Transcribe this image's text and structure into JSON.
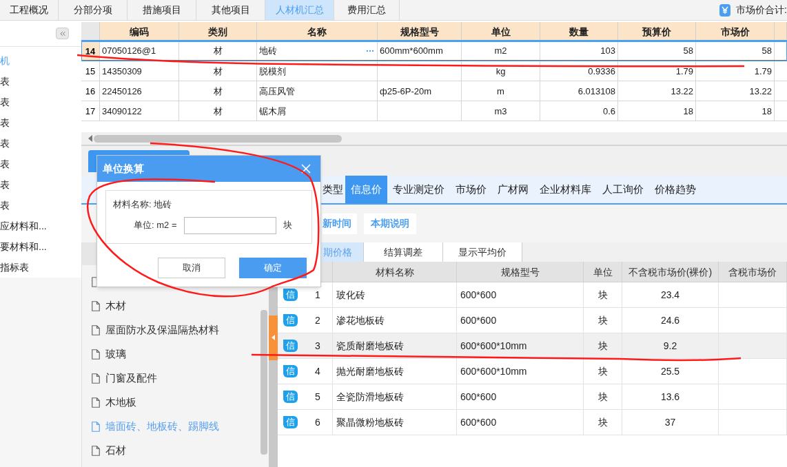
{
  "top_tabs": [
    {
      "label": "工程概况",
      "selected": false
    },
    {
      "label": "分部分项",
      "selected": false
    },
    {
      "label": "措施项目",
      "selected": false
    },
    {
      "label": "其他项目",
      "selected": false
    },
    {
      "label": "人材机汇总",
      "selected": true
    },
    {
      "label": "费用汇总",
      "selected": false
    }
  ],
  "market_total": {
    "label": "市场价合计:"
  },
  "sidebar": {
    "items": [
      {
        "label": "机",
        "selected": true
      },
      {
        "label": "表",
        "selected": false
      },
      {
        "label": "表",
        "selected": false
      },
      {
        "label": "表",
        "selected": false
      },
      {
        "label": "表",
        "selected": false
      },
      {
        "label": "表",
        "selected": false
      },
      {
        "label": "表",
        "selected": false
      },
      {
        "label": "表",
        "selected": false
      },
      {
        "label": "应材料和...",
        "selected": false
      },
      {
        "label": "要材料和...",
        "selected": false
      },
      {
        "label": "指标表",
        "selected": false
      }
    ]
  },
  "material_table": {
    "columns": [
      "编码",
      "类别",
      "名称",
      "规格型号",
      "单位",
      "数量",
      "预算价",
      "市场价"
    ],
    "rows": [
      {
        "number": "14",
        "cells": [
          "07050126@1",
          "材",
          "地砖",
          "600mm*600mm",
          "m2",
          "103",
          "58",
          "58"
        ],
        "selected": true
      },
      {
        "number": "15",
        "cells": [
          "14350309",
          "材",
          "脱模剂",
          "",
          "kg",
          "0.9336",
          "1.79",
          "1.79"
        ],
        "selected": false
      },
      {
        "number": "16",
        "cells": [
          "22450126",
          "材",
          "高压风管",
          "ф25-6P-20m",
          "m",
          "6.013108",
          "13.22",
          "13.22"
        ],
        "selected": false
      },
      {
        "number": "17",
        "cells": [
          "34090122",
          "材",
          "锯木屑",
          "",
          "m3",
          "0.6",
          "18",
          "18"
        ],
        "selected": false
      }
    ]
  },
  "price_tabs": [
    {
      "label": "类型",
      "selected": false
    },
    {
      "label": "信息价",
      "selected": true
    },
    {
      "label": "专业测定价",
      "selected": false
    },
    {
      "label": "市场价",
      "selected": false
    },
    {
      "label": "广材网",
      "selected": false
    },
    {
      "label": "企业材料库",
      "selected": false
    },
    {
      "label": "人工询价",
      "selected": false
    },
    {
      "label": "价格趋势",
      "selected": false
    }
  ],
  "actions": [
    "新时间",
    "本期说明"
  ],
  "sub_tabs": [
    {
      "label": "期价格",
      "selected": true
    },
    {
      "label": "结算调差",
      "selected": false
    },
    {
      "label": "显示平均价",
      "selected": false
    }
  ],
  "category_tree": {
    "items": [
      {
        "selected": false
      },
      {
        "label": "木材",
        "selected": false
      },
      {
        "label": "屋面防水及保温隔热材料",
        "selected": false
      },
      {
        "label": "玻璃",
        "selected": false
      },
      {
        "label": "门窗及配件",
        "selected": false
      },
      {
        "label": "木地板",
        "selected": false
      },
      {
        "label": "墙面砖、地板砖、踢脚线",
        "selected": true
      },
      {
        "label": "石材",
        "selected": false
      }
    ]
  },
  "price_table": {
    "columns": [
      "材料名称",
      "规格型号",
      "单位",
      "不含税市场价(裸价)",
      "含税市场价"
    ],
    "rows": [
      {
        "badge": "信",
        "number": "1",
        "name": "玻化砖",
        "spec": "600*600",
        "unit": "块",
        "price": "23.4",
        "selected": false
      },
      {
        "badge": "信",
        "number": "2",
        "name": "渗花地板砖",
        "spec": "600*600",
        "unit": "块",
        "price": "24.6",
        "selected": false
      },
      {
        "badge": "信",
        "number": "3",
        "name": "瓷质耐磨地板砖",
        "spec": "600*600*10mm",
        "unit": "块",
        "price": "9.2",
        "selected": true
      },
      {
        "badge": "信",
        "number": "4",
        "name": "抛光耐磨地板砖",
        "spec": "600*600*10mm",
        "unit": "块",
        "price": "25.5",
        "selected": false
      },
      {
        "badge": "信",
        "number": "5",
        "name": "全瓷防滑地板砖",
        "spec": "600*600",
        "unit": "块",
        "price": "13.6",
        "selected": false
      },
      {
        "badge": "信",
        "number": "6",
        "name": "聚晶微粉地板砖",
        "spec": "600*600",
        "unit": "块",
        "price": "37",
        "selected": false
      }
    ]
  },
  "dialog": {
    "title": "单位换算",
    "material": "材料名称: 地砖",
    "unit_label": "单位: m2 =",
    "unit_suffix": "块",
    "buttons": [
      {
        "label": "取消",
        "kind": "secondary"
      },
      {
        "label": "确定",
        "kind": "primary"
      }
    ]
  }
}
